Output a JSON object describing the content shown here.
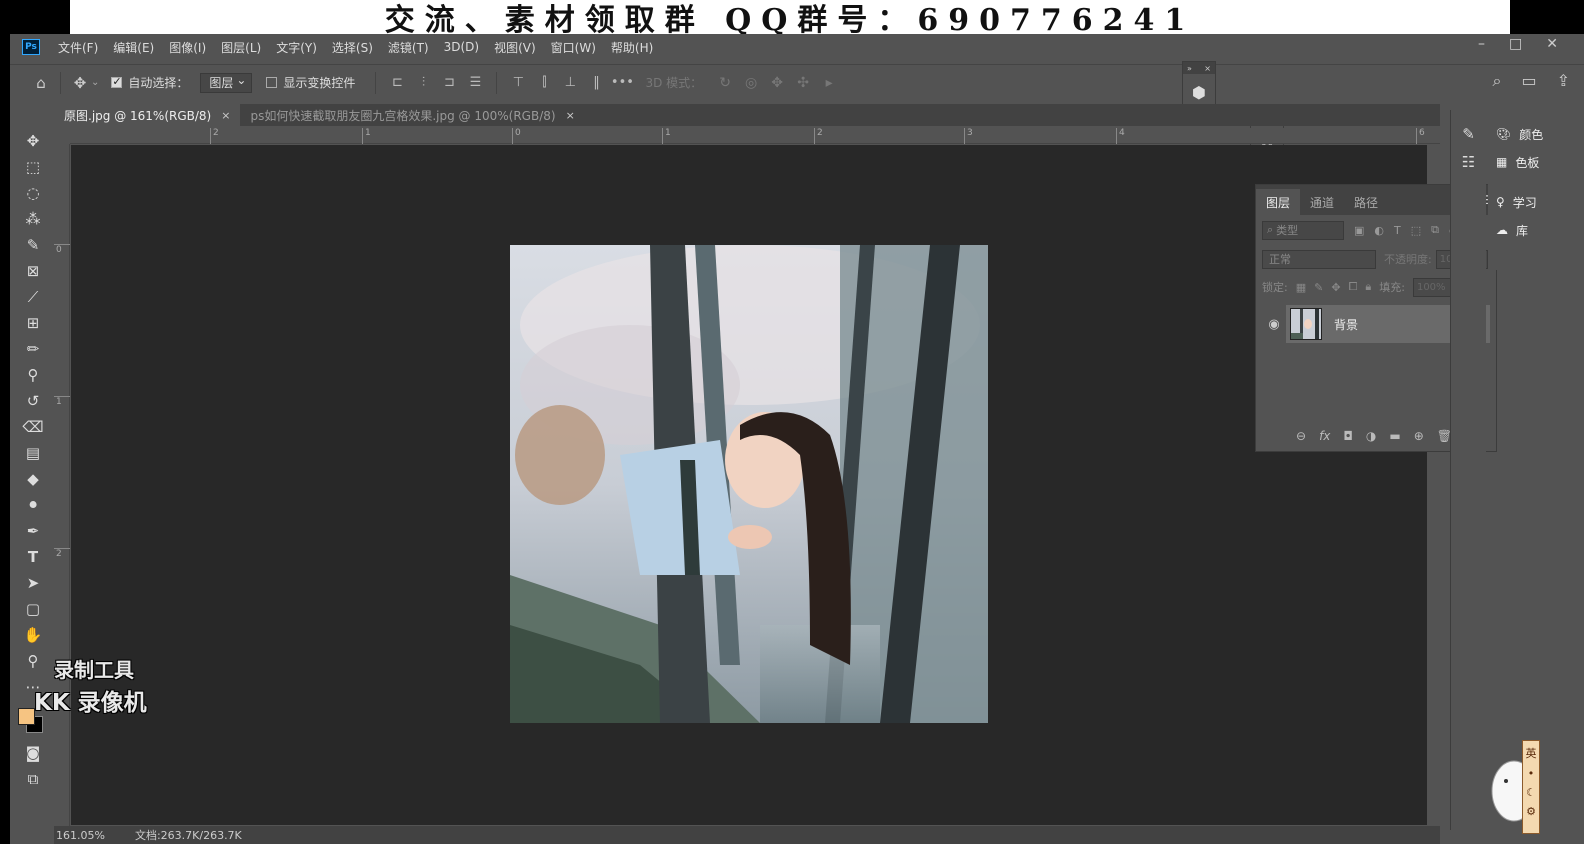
{
  "banner": {
    "text": "交流、素材领取群  QQ群号：690776241"
  },
  "app": {
    "logo": "Ps",
    "menu": [
      "文件(F)",
      "编辑(E)",
      "图像(I)",
      "图层(L)",
      "文字(Y)",
      "选择(S)",
      "滤镜(T)",
      "3D(D)",
      "视图(V)",
      "窗口(W)",
      "帮助(H)"
    ],
    "window_controls": [
      "–",
      "□",
      "✕"
    ]
  },
  "options": {
    "auto_select_label": "自动选择：",
    "auto_select_value": "图层",
    "show_transform_label": "显示变换控件",
    "mode_3d_label": "3D 模式："
  },
  "tabs": [
    {
      "label": "原图.jpg @ 161%(RGB/8)",
      "close": "×"
    },
    {
      "label": "ps如何快速截取朋友圈九宫格效果.jpg @ 100%(RGB/8)",
      "close": "×"
    }
  ],
  "ruler": {
    "h_ticks": [
      "2",
      "1",
      "0",
      "1",
      "2",
      "3",
      "4",
      "6"
    ],
    "v_ticks": [
      "0",
      "1",
      "2"
    ]
  },
  "status": {
    "zoom": "161.05%",
    "doc": "文档:263.7K/263.7K"
  },
  "watermark": {
    "line1": "录制工具",
    "line2": "KK 录像机"
  },
  "layers_panel": {
    "tabs": [
      "图层",
      "通道",
      "路径"
    ],
    "filter_placeholder": "类型",
    "blend_mode": "正常",
    "opacity_label": "不透明度:",
    "opacity_value": "100%",
    "lock_label": "锁定:",
    "fill_label": "填充:",
    "fill_value": "100%",
    "layer_name": "背景"
  },
  "right_panel": {
    "items": [
      "颜色",
      "色板",
      "学习",
      "库"
    ]
  },
  "ime": {
    "label": "英"
  },
  "icons": {
    "home": "home-icon",
    "move": "move-icon",
    "search": "search-icon",
    "workspace": "workspace-icon",
    "share": "share-icon",
    "eye": "eye-icon",
    "lock": "lock-icon"
  }
}
